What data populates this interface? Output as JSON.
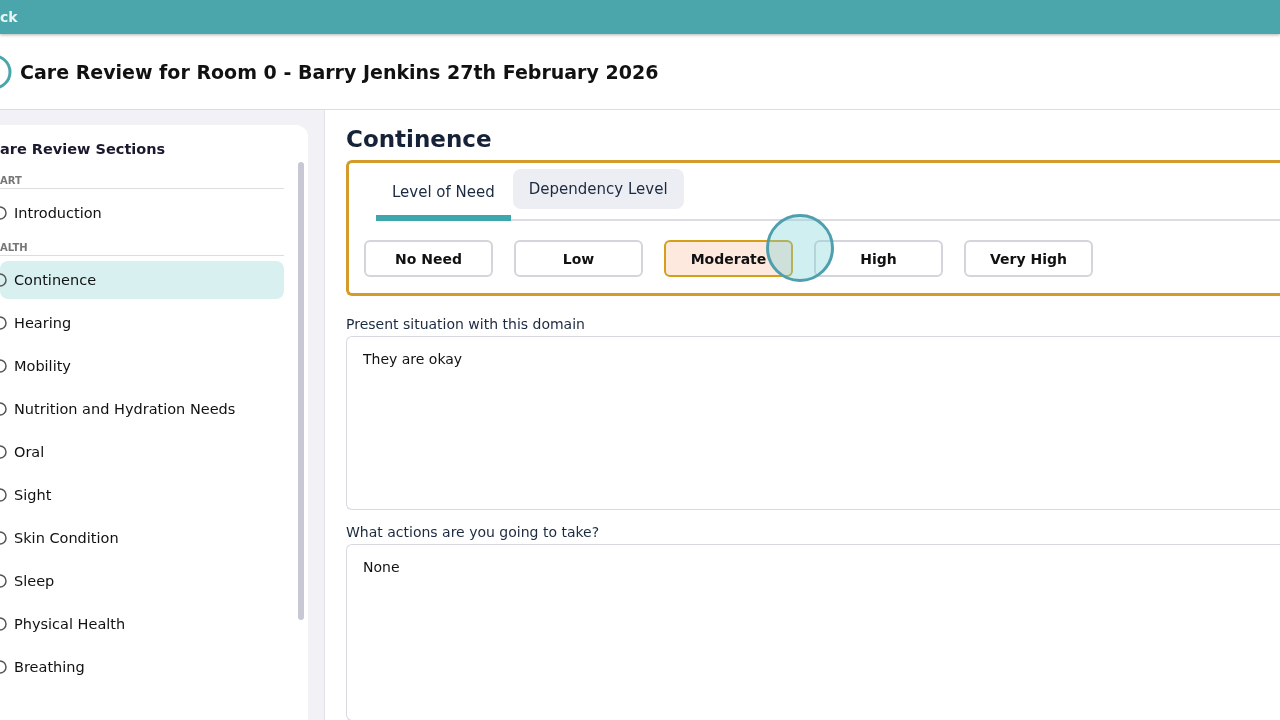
{
  "top_bar": {
    "back_label": "ck"
  },
  "header": {
    "title": "Care Review for Room 0 - Barry Jenkins 27th February 2026"
  },
  "sidebar": {
    "title": "are Review Sections",
    "groups": [
      {
        "label": "ART",
        "items": [
          {
            "label": "Introduction",
            "selected": false
          }
        ]
      },
      {
        "label": "ALTH",
        "items": [
          {
            "label": "Continence",
            "selected": true
          },
          {
            "label": "Hearing",
            "selected": false
          },
          {
            "label": "Mobility",
            "selected": false
          },
          {
            "label": "Nutrition and Hydration Needs",
            "selected": false
          },
          {
            "label": "Oral",
            "selected": false
          },
          {
            "label": "Sight",
            "selected": false
          },
          {
            "label": "Skin Condition",
            "selected": false
          },
          {
            "label": "Sleep",
            "selected": false
          },
          {
            "label": "Physical Health",
            "selected": false
          },
          {
            "label": "Breathing",
            "selected": false
          }
        ]
      }
    ]
  },
  "section": {
    "title": "Continence",
    "tabs": [
      {
        "label": "Level of Need",
        "selected": true
      },
      {
        "label": "Dependency Level",
        "selected": false
      }
    ],
    "levels": [
      {
        "label": "No Need",
        "selected": false
      },
      {
        "label": "Low",
        "selected": false
      },
      {
        "label": "Moderate",
        "selected": true
      },
      {
        "label": "High",
        "selected": false
      },
      {
        "label": "Very High",
        "selected": false
      }
    ],
    "fields": [
      {
        "label": "Present situation with this domain",
        "value": "They are okay"
      },
      {
        "label": "What actions are you going to take?",
        "value": "None"
      }
    ]
  }
}
